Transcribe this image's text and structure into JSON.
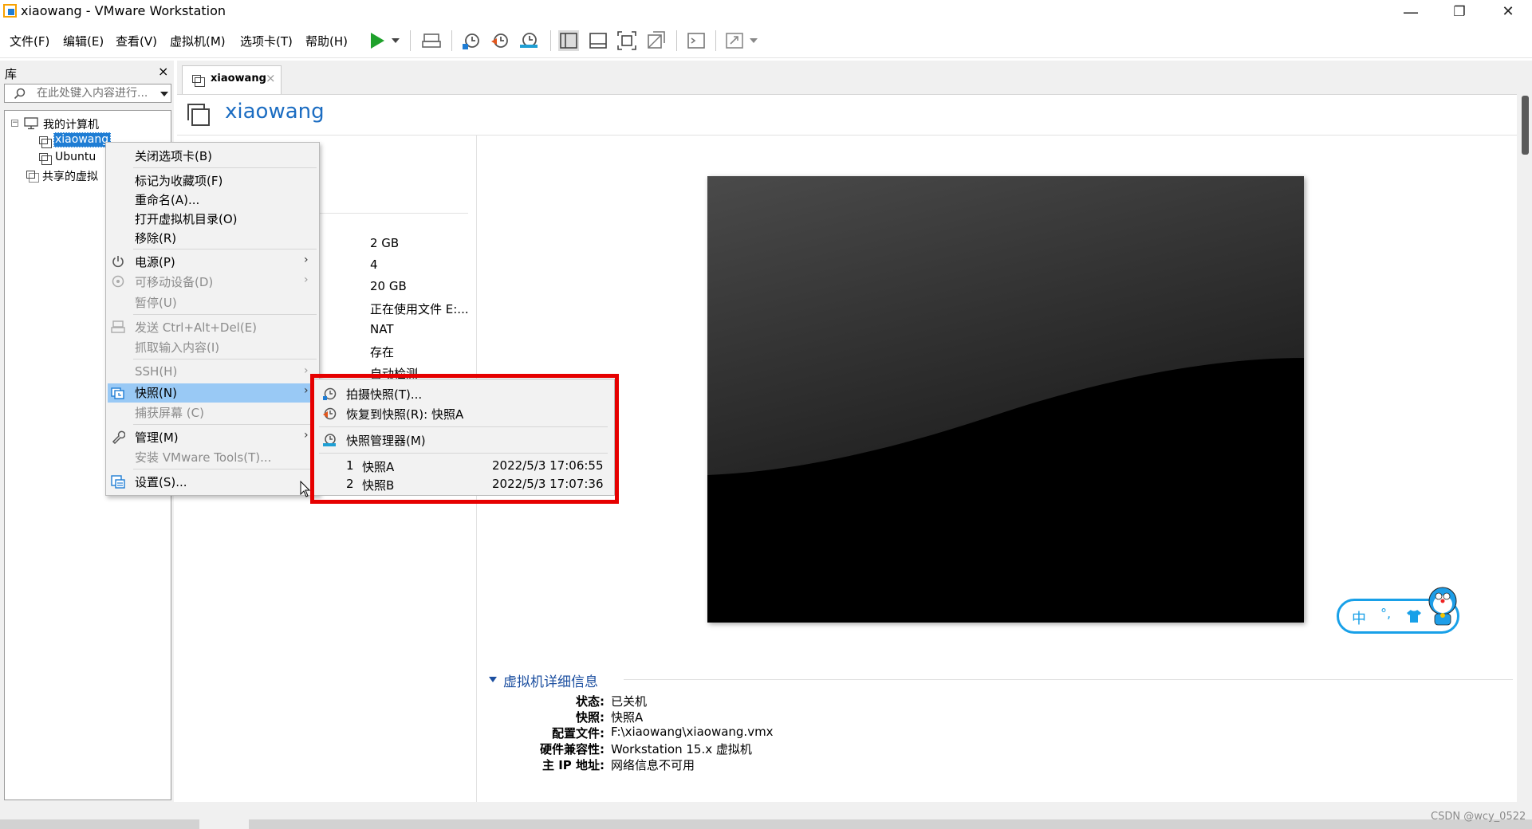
{
  "window": {
    "title": "xiaowang - VMware Workstation",
    "minimize": "—",
    "restore": "❐",
    "close": "✕"
  },
  "menubar": {
    "items": [
      "文件(F)",
      "编辑(E)",
      "查看(V)",
      "虚拟机(M)",
      "选项卡(T)",
      "帮助(H)"
    ]
  },
  "library": {
    "title": "库",
    "close": "×",
    "search_placeholder": "在此处键入内容进行...",
    "tree": {
      "root": "我的计算机",
      "vms": [
        "xiaowang",
        "Ubuntu"
      ],
      "shared": "共享的虚拟"
    }
  },
  "tab": {
    "label": "xiaowang",
    "close": "×"
  },
  "vm": {
    "name": "xiaowang",
    "devices": [
      "2 GB",
      "4",
      "20 GB",
      "正在使用文件 E:...",
      "NAT",
      "存在",
      "自动检测"
    ]
  },
  "details": {
    "section_title": "虚拟机详细信息",
    "rows": [
      {
        "key": "状态:",
        "value": "已关机"
      },
      {
        "key": "快照:",
        "value": "快照A"
      },
      {
        "key": "配置文件:",
        "value": "F:\\xiaowang\\xiaowang.vmx"
      },
      {
        "key": "硬件兼容性:",
        "value": "Workstation 15.x 虚拟机"
      },
      {
        "key": "主 IP 地址:",
        "value": "网络信息不可用"
      }
    ]
  },
  "context_menu": {
    "close_tab": "关闭选项卡(B)",
    "favorite": "标记为收藏项(F)",
    "rename": "重命名(A)...",
    "open_dir": "打开虚拟机目录(O)",
    "remove": "移除(R)",
    "power": "电源(P)",
    "removable": "可移动设备(D)",
    "pause": "暂停(U)",
    "send_cad": "发送 Ctrl+Alt+Del(E)",
    "grab_input": "抓取输入内容(I)",
    "ssh": "SSH(H)",
    "snapshot": "快照(N)",
    "capture_screen": "捕获屏幕 (C)",
    "manage": "管理(M)",
    "install_tools": "安装 VMware Tools(T)...",
    "settings": "设置(S)..."
  },
  "snapshot_submenu": {
    "take": "拍摄快照(T)...",
    "revert": "恢复到快照(R): 快照A",
    "manager": "快照管理器(M)",
    "snapshots": [
      {
        "num": "1",
        "name": "快照A",
        "time": "2022/5/3 17:06:55"
      },
      {
        "num": "2",
        "name": "快照B",
        "time": "2022/5/3 17:07:36"
      }
    ]
  },
  "ime": {
    "lang": "中",
    "punct": "°,"
  },
  "watermark": "CSDN @wcy_0522",
  "colors": {
    "accent": "#1c6dc2",
    "highlight": "#99c9f5",
    "annotation_red": "#e60000",
    "play_green": "#1fa12b"
  }
}
